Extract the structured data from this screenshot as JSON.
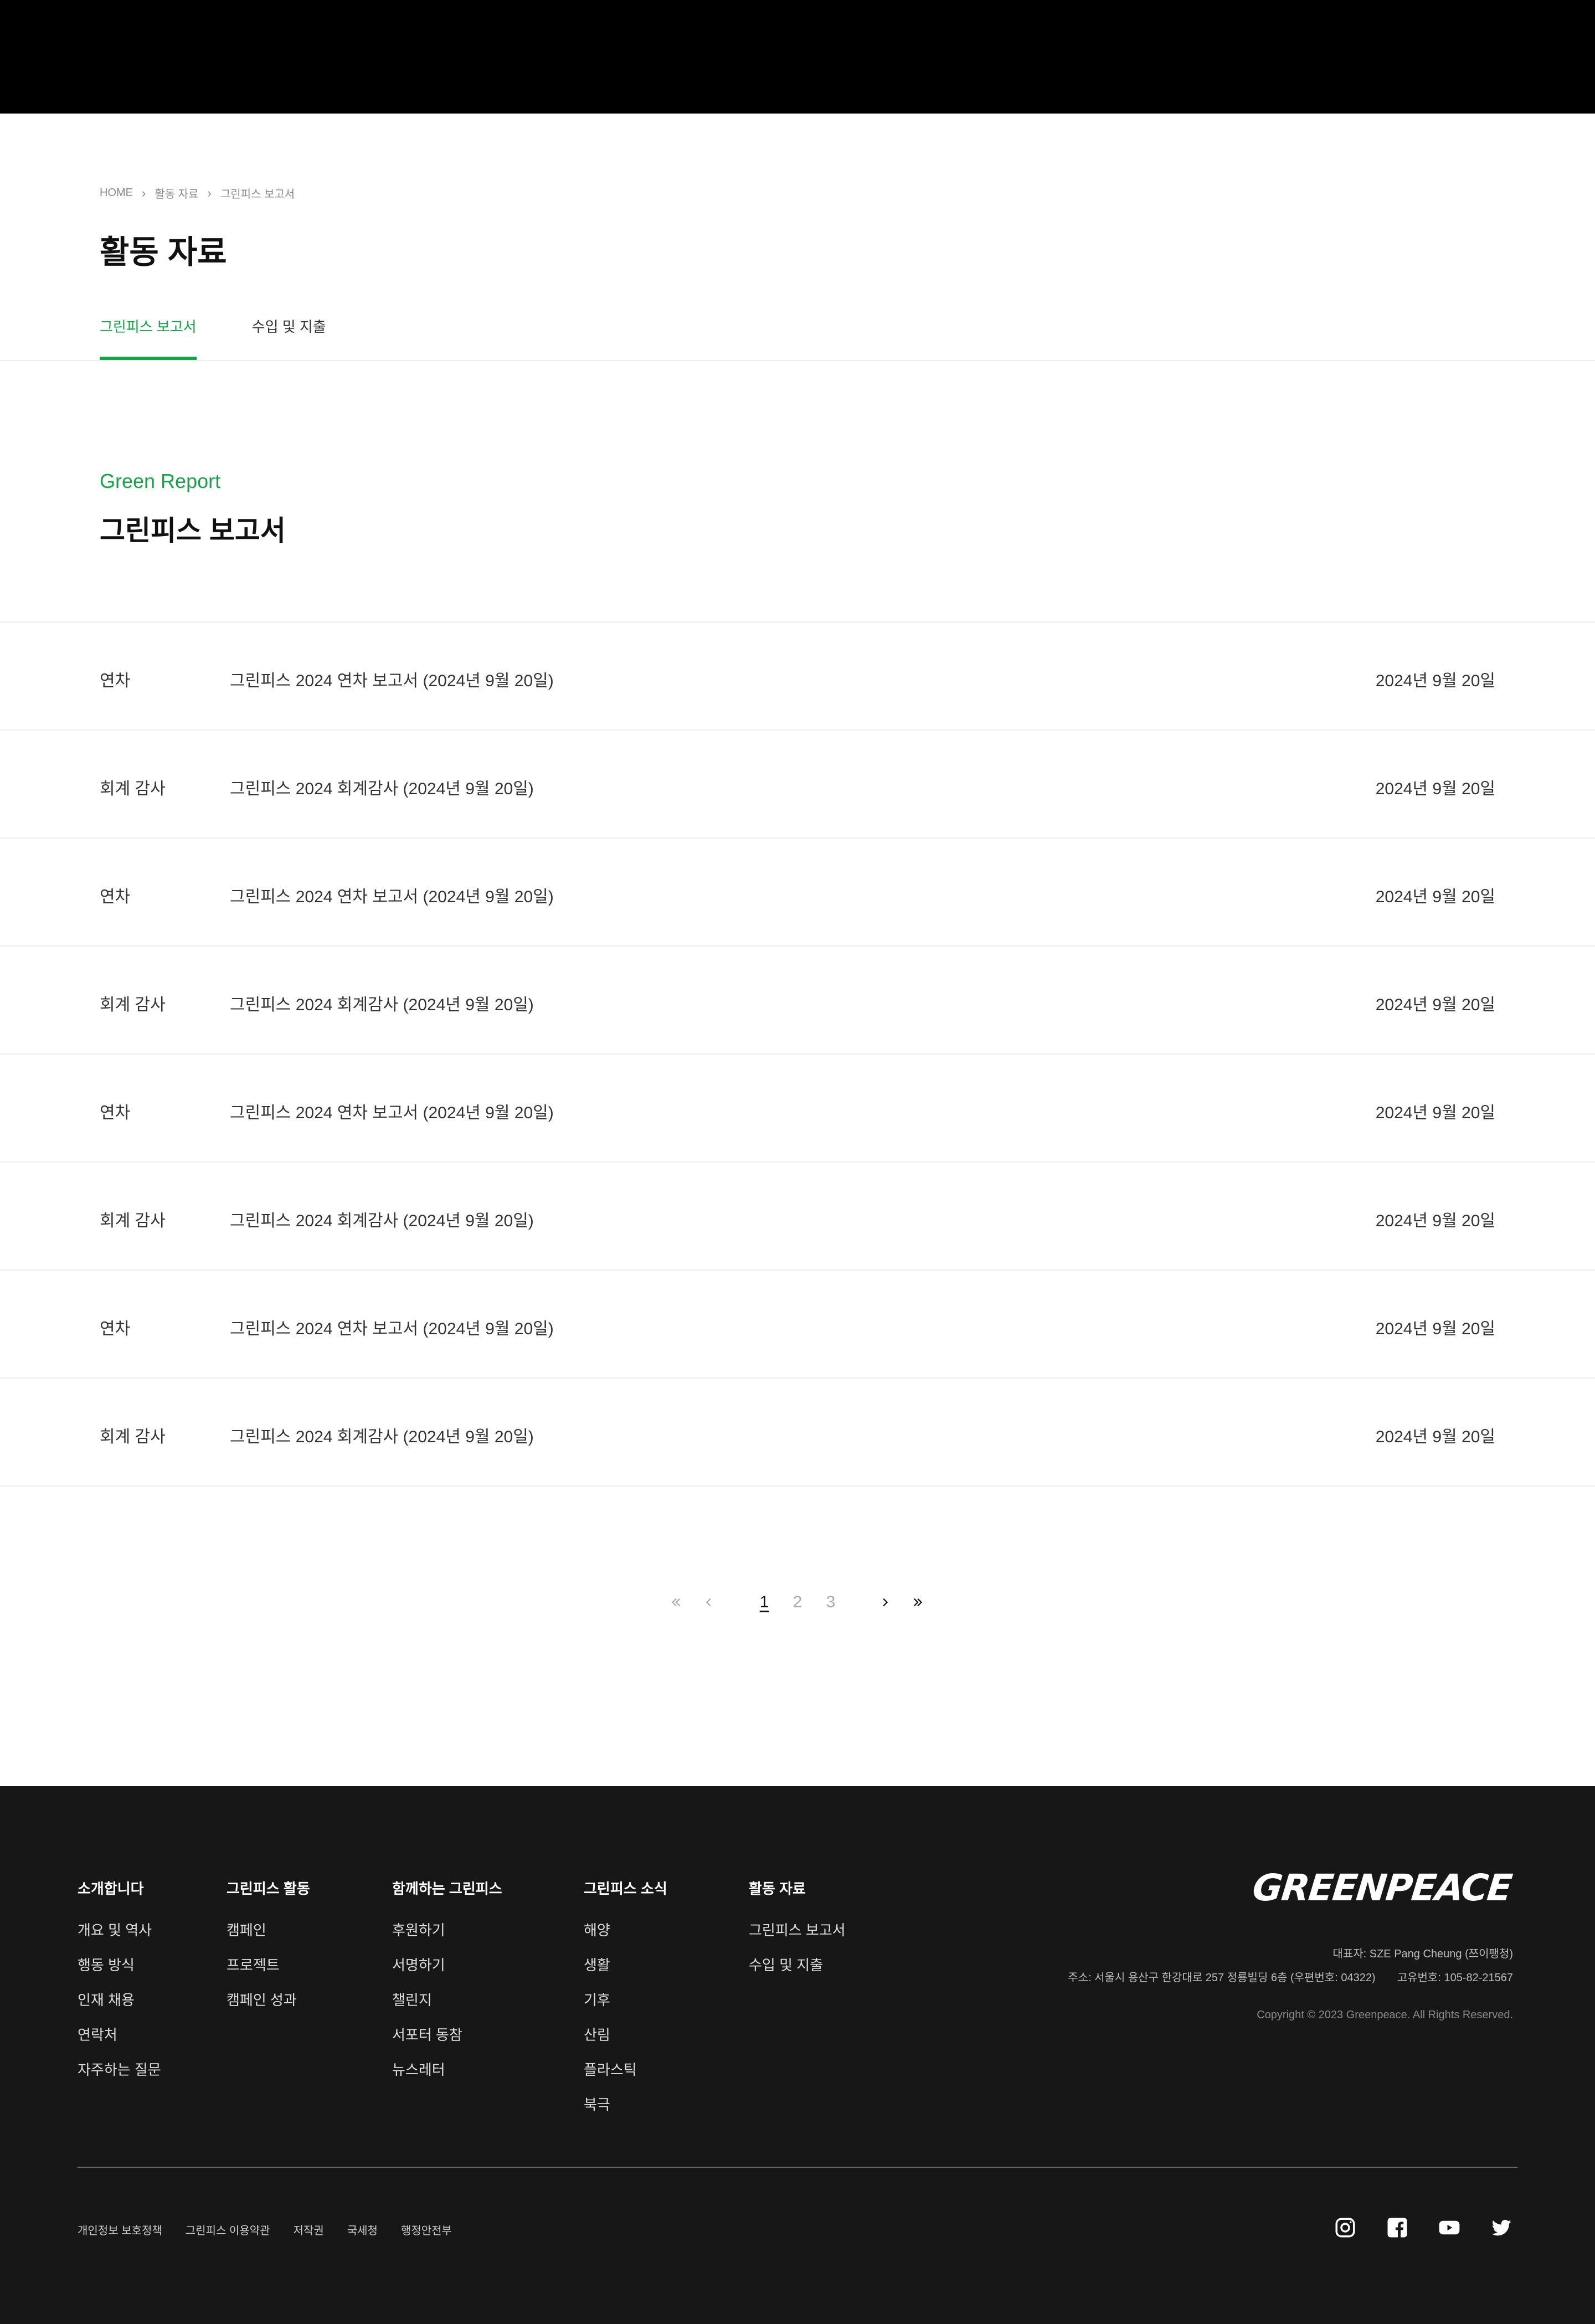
{
  "breadcrumb": [
    "HOME",
    "활동 자료",
    "그린피스 보고서"
  ],
  "page_title": "활동 자료",
  "tabs": [
    {
      "label": "그린피스 보고서",
      "active": true
    },
    {
      "label": "수입 및 지출",
      "active": false
    }
  ],
  "section": {
    "eyebrow": "Green Report",
    "title": "그린피스 보고서"
  },
  "reports": [
    {
      "category": "연차",
      "title": "그린피스 2024 연차 보고서 (2024년 9월 20일)",
      "date": "2024년 9월 20일"
    },
    {
      "category": "회계 감사",
      "title": "그린피스 2024 회계감사 (2024년 9월 20일)",
      "date": "2024년 9월 20일"
    },
    {
      "category": "연차",
      "title": "그린피스 2024 연차 보고서 (2024년 9월 20일)",
      "date": "2024년 9월 20일"
    },
    {
      "category": "회계 감사",
      "title": "그린피스 2024 회계감사 (2024년 9월 20일)",
      "date": "2024년 9월 20일"
    },
    {
      "category": "연차",
      "title": "그린피스 2024 연차 보고서 (2024년 9월 20일)",
      "date": "2024년 9월 20일"
    },
    {
      "category": "회계 감사",
      "title": "그린피스 2024 회계감사 (2024년 9월 20일)",
      "date": "2024년 9월 20일"
    },
    {
      "category": "연차",
      "title": "그린피스 2024 연차 보고서 (2024년 9월 20일)",
      "date": "2024년 9월 20일"
    },
    {
      "category": "회계 감사",
      "title": "그린피스 2024 회계감사 (2024년 9월 20일)",
      "date": "2024년 9월 20일"
    }
  ],
  "pagination": {
    "pages": [
      "1",
      "2",
      "3"
    ],
    "current": "1"
  },
  "footer": {
    "columns": [
      {
        "heading": "소개합니다",
        "links": [
          "개요 및 역사",
          "행동 방식",
          "인재 채용",
          "연락처",
          "자주하는 질문"
        ]
      },
      {
        "heading": "그린피스 활동",
        "links": [
          "캠페인",
          "프로젝트",
          "캠페인 성과"
        ]
      },
      {
        "heading": "함께하는 그린피스",
        "links": [
          "후원하기",
          "서명하기",
          "챌린지",
          "서포터 동참",
          "뉴스레터"
        ]
      },
      {
        "heading": "그린피스 소식",
        "links": [
          "해양",
          "생활",
          "기후",
          "산림",
          "플라스틱",
          "북극"
        ]
      },
      {
        "heading": "활동 자료",
        "links": [
          "그린피스 보고서",
          "수입 및 지출"
        ]
      }
    ],
    "logo": "GREENPEACE",
    "representative": "대표자: SZE Pang Cheung (쯔이팽청)",
    "address": "주소: 서울시 용산구 한강대로 257 정룡빌딩 6층 (우편번호: 04322)",
    "business_no": "고유번호: 105-82-21567",
    "copyright": "Copyright © 2023 Greenpeace. All Rights Reserved.",
    "bottom_links": [
      "개인정보 보호정책",
      "그린피스 이용약관",
      "저작권",
      "국세청",
      "행정안전부"
    ],
    "social": [
      "instagram-icon",
      "facebook-icon",
      "youtube-icon",
      "twitter-icon"
    ]
  },
  "colors": {
    "accent": "#17a349",
    "footer_bg": "#171717",
    "topbar": "#000000"
  }
}
